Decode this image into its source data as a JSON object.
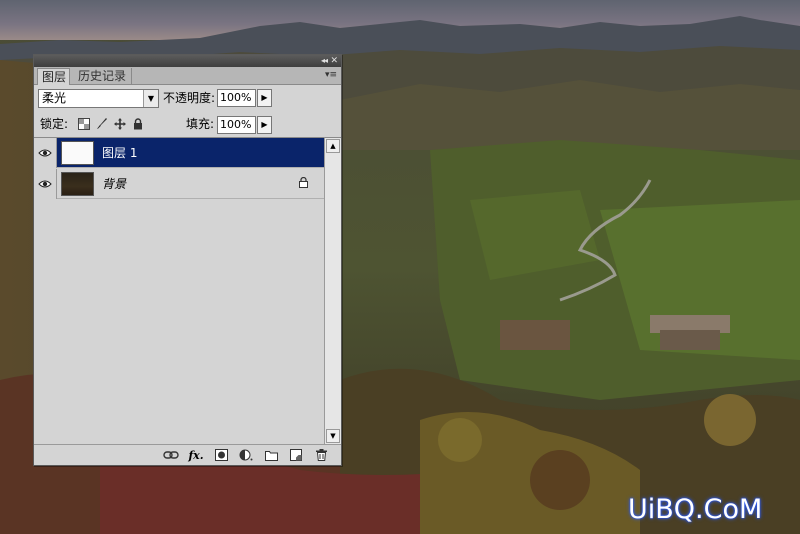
{
  "panel": {
    "tabs": [
      {
        "label": "图层",
        "active": true
      },
      {
        "label": "历史记录",
        "active": false
      }
    ],
    "blend_mode": "柔光",
    "opacity_label": "不透明度:",
    "opacity_value": "100%",
    "lock_label": "锁定:",
    "fill_label": "填充:",
    "fill_value": "100%",
    "layers": [
      {
        "name": "图层 1",
        "selected": true,
        "visible": true,
        "locked": false
      },
      {
        "name": "背景",
        "selected": false,
        "visible": true,
        "locked": true
      }
    ],
    "bottom_icons": [
      "link-layers-icon",
      "fx-icon",
      "add-mask-icon",
      "adjustment-layer-icon",
      "new-group-icon",
      "new-layer-icon",
      "trash-icon"
    ]
  },
  "watermark": "UiBQ.CoM",
  "colors": {
    "selection": "#0a246a",
    "panel_bg": "#d4d4d4",
    "watermark_glow": "#2a5cff"
  }
}
